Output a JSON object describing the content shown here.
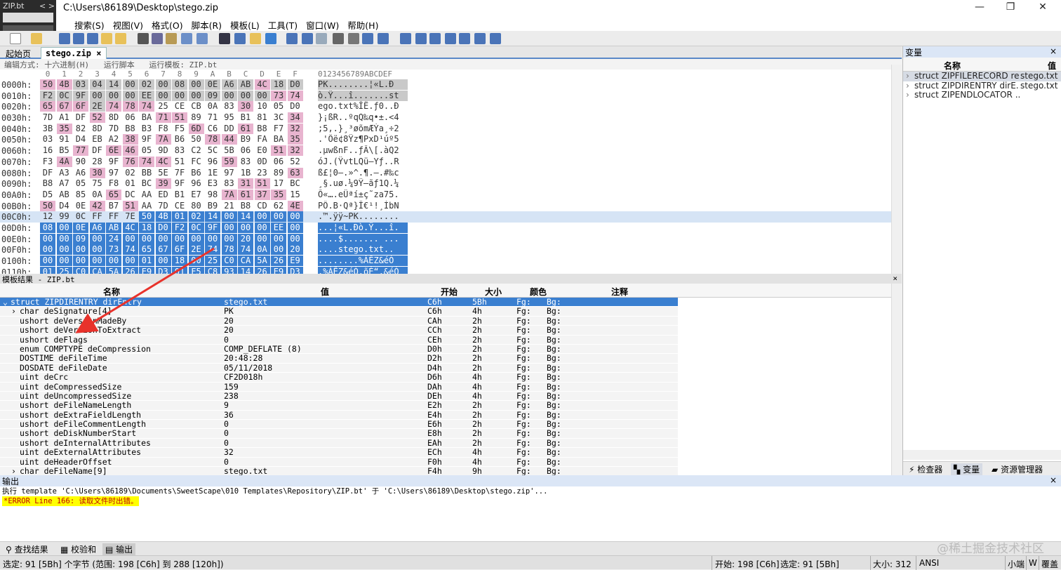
{
  "window": {
    "title": "C:\\Users\\86189\\Desktop\\stego.zip",
    "mini_tab_label": "ZIP.bt",
    "mini_tab_nav": "< >",
    "minimize": "—",
    "maximize": "❐",
    "close": "✕"
  },
  "menu": [
    "搜索(S)",
    "视图(V)",
    "格式(O)",
    "脚本(R)",
    "模板(L)",
    "工具(T)",
    "窗口(W)",
    "帮助(H)"
  ],
  "tabs": {
    "start": "起始页",
    "file": "stego.zip",
    "file_close": "×"
  },
  "hex_info": {
    "edit_mode": "编辑方式: 十六进制(H)",
    "run_script": "运行脚本",
    "run_template": "运行模板: ZIP.bt"
  },
  "hex_col_labels": [
    "0",
    "1",
    "2",
    "3",
    "4",
    "5",
    "6",
    "7",
    "8",
    "9",
    "A",
    "B",
    "C",
    "D",
    "E",
    "F"
  ],
  "hex_ascii_header": "0123456789ABCDEF",
  "hex_rows": [
    {
      "off": "0000h:",
      "b": [
        "50",
        "4B",
        "03",
        "04",
        "14",
        "00",
        "02",
        "00",
        "08",
        "00",
        "0E",
        "A6",
        "AB",
        "4C",
        "18",
        "D0"
      ],
      "a": "PK........¦«L.Ð"
    },
    {
      "off": "0010h:",
      "b": [
        "F2",
        "0C",
        "9F",
        "00",
        "00",
        "00",
        "EE",
        "00",
        "00",
        "00",
        "09",
        "00",
        "00",
        "00",
        "73",
        "74"
      ],
      "a": "ò.Ÿ...î.......st"
    },
    {
      "off": "0020h:",
      "b": [
        "65",
        "67",
        "6F",
        "2E",
        "74",
        "78",
        "74",
        "25",
        "CE",
        "CB",
        "0A",
        "83",
        "30",
        "10",
        "05",
        "D0"
      ],
      "a": "ego.txt%ÎË.ƒ0..Ð"
    },
    {
      "off": "0030h:",
      "b": [
        "7D",
        "A1",
        "DF",
        "52",
        "8D",
        "06",
        "BA",
        "71",
        "51",
        "89",
        "71",
        "95",
        "B1",
        "81",
        "3C",
        "34"
      ],
      "a": "}¡ßR..ºqQ‰q•±.<4"
    },
    {
      "off": "0040h:",
      "b": [
        "3B",
        "35",
        "82",
        "8D",
        "7D",
        "B8",
        "B3",
        "F8",
        "F5",
        "6D",
        "C6",
        "DD",
        "61",
        "B8",
        "F7",
        "32"
      ],
      "a": ";5‚.}¸³øõmÆÝa¸÷2"
    },
    {
      "off": "0050h:",
      "b": [
        "03",
        "91",
        "D4",
        "EB",
        "A2",
        "38",
        "9F",
        "7A",
        "B6",
        "50",
        "78",
        "44",
        "B9",
        "FA",
        "BA",
        "35"
      ],
      "a": ".'Ôë¢8Ÿz¶PxD¹úº5"
    },
    {
      "off": "0060h:",
      "b": [
        "16",
        "B5",
        "77",
        "DF",
        "6E",
        "46",
        "05",
        "9D",
        "83",
        "C2",
        "5C",
        "5B",
        "06",
        "E0",
        "51",
        "32"
      ],
      "a": ".µwßnF..ƒÂ\\[.àQ2"
    },
    {
      "off": "0070h:",
      "b": [
        "F3",
        "4A",
        "90",
        "28",
        "9F",
        "76",
        "74",
        "4C",
        "51",
        "FC",
        "96",
        "59",
        "83",
        "0D",
        "06",
        "52"
      ],
      "a": "óJ.(ŸvtLQü–Yƒ..R"
    },
    {
      "off": "0080h:",
      "b": [
        "DF",
        "A3",
        "A6",
        "30",
        "97",
        "02",
        "BB",
        "5E",
        "7F",
        "B6",
        "1E",
        "97",
        "1B",
        "23",
        "89",
        "63"
      ],
      "a": "ß£¦0—.»^.¶.—.#‰c"
    },
    {
      "off": "0090h:",
      "b": [
        "B8",
        "A7",
        "05",
        "75",
        "F8",
        "01",
        "BC",
        "39",
        "9F",
        "96",
        "E3",
        "83",
        "31",
        "51",
        "17",
        "BC"
      ],
      "a": "¸§.uø.¼9Ÿ–ãƒ1Q.¼"
    },
    {
      "off": "00A0h:",
      "b": [
        "D5",
        "AB",
        "85",
        "0A",
        "65",
        "DC",
        "AA",
        "ED",
        "B1",
        "E7",
        "98",
        "7A",
        "61",
        "37",
        "35",
        "15"
      ],
      "a": "Õ«….eÜªí±ç˜za75."
    },
    {
      "off": "00B0h:",
      "b": [
        "50",
        "D4",
        "0E",
        "42",
        "B7",
        "51",
        "AA",
        "7D",
        "CE",
        "80",
        "B9",
        "21",
        "B8",
        "CD",
        "62",
        "4E"
      ],
      "a": "PÔ.B·Qª}Î€¹!¸ÍbN"
    },
    {
      "off": "00C0h:",
      "b": [
        "12",
        "99",
        "0C",
        "FF",
        "FF",
        "7E",
        "50",
        "4B",
        "01",
        "02",
        "14",
        "00",
        "14",
        "00",
        "00",
        "00"
      ],
      "a": ".™.ÿÿ~PK........"
    },
    {
      "off": "00D0h:",
      "b": [
        "08",
        "00",
        "0E",
        "A6",
        "AB",
        "4C",
        "18",
        "D0",
        "F2",
        "0C",
        "9F",
        "00",
        "00",
        "00",
        "EE",
        "00"
      ],
      "a": "...¦«L.Ðò.Ÿ...î."
    },
    {
      "off": "00E0h:",
      "b": [
        "00",
        "00",
        "09",
        "00",
        "24",
        "00",
        "00",
        "00",
        "00",
        "00",
        "00",
        "00",
        "20",
        "00",
        "00",
        "00"
      ],
      "a": "....$....... ..."
    },
    {
      "off": "00F0h:",
      "b": [
        "00",
        "00",
        "00",
        "00",
        "73",
        "74",
        "65",
        "67",
        "6F",
        "2E",
        "74",
        "78",
        "74",
        "0A",
        "00",
        "20"
      ],
      "a": "....stego.txt.. "
    },
    {
      "off": "0100h:",
      "b": [
        "00",
        "00",
        "00",
        "00",
        "00",
        "00",
        "01",
        "00",
        "18",
        "00",
        "25",
        "C0",
        "CA",
        "5A",
        "26",
        "E9",
        "D3"
      ],
      "a": "........%ÀÊZ&éÓ"
    },
    {
      "off": "0110h:",
      "b": [
        "01",
        "25",
        "C0",
        "CA",
        "5A",
        "26",
        "E9",
        "D3",
        "01",
        "F5",
        "C8",
        "93",
        "14",
        "26",
        "E9",
        "D3"
      ],
      "a": ".%ÀÊZ&éÓ.õÈ“.&éÓ"
    }
  ],
  "template": {
    "title": "模板结果 - ZIP.bt",
    "close": "×",
    "headers": {
      "name": "名称",
      "value": "值",
      "start": "开始",
      "size": "大小",
      "color": "颜色",
      "comment": "注释"
    },
    "rows": [
      {
        "name": "struct ZIPDIRENTRY dirEntry",
        "value": "stego.txt",
        "start": "C6h",
        "size": "5Bh",
        "fg": "Fg:",
        "bg": "Bg:"
      },
      {
        "name": "char deSignature[4]",
        "value": "PK",
        "start": "C6h",
        "size": "4h",
        "fg": "Fg:",
        "bg": "Bg:"
      },
      {
        "name": "ushort deVersionMadeBy",
        "value": "20",
        "start": "CAh",
        "size": "2h",
        "fg": "Fg:",
        "bg": "Bg:"
      },
      {
        "name": "ushort deVersionToExtract",
        "value": "20",
        "start": "CCh",
        "size": "2h",
        "fg": "Fg:",
        "bg": "Bg:"
      },
      {
        "name": "ushort deFlags",
        "value": "0",
        "start": "CEh",
        "size": "2h",
        "fg": "Fg:",
        "bg": "Bg:"
      },
      {
        "name": "enum COMPTYPE deCompression",
        "value": "COMP_DEFLATE (8)",
        "start": "D0h",
        "size": "2h",
        "fg": "Fg:",
        "bg": "Bg:"
      },
      {
        "name": "DOSTIME deFileTime",
        "value": "20:48:28",
        "start": "D2h",
        "size": "2h",
        "fg": "Fg:",
        "bg": "Bg:"
      },
      {
        "name": "DOSDATE deFileDate",
        "value": "05/11/2018",
        "start": "D4h",
        "size": "2h",
        "fg": "Fg:",
        "bg": "Bg:"
      },
      {
        "name": "uint deCrc",
        "value": "CF2D018h",
        "start": "D6h",
        "size": "4h",
        "fg": "Fg:",
        "bg": "Bg:"
      },
      {
        "name": "uint deCompressedSize",
        "value": "159",
        "start": "DAh",
        "size": "4h",
        "fg": "Fg:",
        "bg": "Bg:"
      },
      {
        "name": "uint deUncompressedSize",
        "value": "238",
        "start": "DEh",
        "size": "4h",
        "fg": "Fg:",
        "bg": "Bg:"
      },
      {
        "name": "ushort deFileNameLength",
        "value": "9",
        "start": "E2h",
        "size": "2h",
        "fg": "Fg:",
        "bg": "Bg:"
      },
      {
        "name": "ushort deExtraFieldLength",
        "value": "36",
        "start": "E4h",
        "size": "2h",
        "fg": "Fg:",
        "bg": "Bg:"
      },
      {
        "name": "ushort deFileCommentLength",
        "value": "0",
        "start": "E6h",
        "size": "2h",
        "fg": "Fg:",
        "bg": "Bg:"
      },
      {
        "name": "ushort deDiskNumberStart",
        "value": "0",
        "start": "E8h",
        "size": "2h",
        "fg": "Fg:",
        "bg": "Bg:"
      },
      {
        "name": "ushort deInternalAttributes",
        "value": "0",
        "start": "EAh",
        "size": "2h",
        "fg": "Fg:",
        "bg": "Bg:"
      },
      {
        "name": "uint deExternalAttributes",
        "value": "32",
        "start": "ECh",
        "size": "4h",
        "fg": "Fg:",
        "bg": "Bg:"
      },
      {
        "name": "uint deHeaderOffset",
        "value": "0",
        "start": "F0h",
        "size": "4h",
        "fg": "Fg:",
        "bg": "Bg:"
      },
      {
        "name": "char deFileName[9]",
        "value": "stego.txt",
        "start": "F4h",
        "size": "9h",
        "fg": "Fg:",
        "bg": "Bg:"
      }
    ]
  },
  "variables": {
    "title": "变量",
    "close": "×",
    "header_name": "名称",
    "header_value": "值",
    "rows": [
      {
        "name": "struct ZIPFILERECORD re...",
        "value": "stego.txt"
      },
      {
        "name": "struct ZIPDIRENTRY dirE...",
        "value": "stego.txt"
      },
      {
        "name": "struct ZIPENDLOCATOR ...",
        "value": ""
      }
    ],
    "tabs": [
      "检查器",
      "变量",
      "资源管理器"
    ]
  },
  "output": {
    "title": "输出",
    "close": "×",
    "line1": "执行 template 'C:\\Users\\86189\\Documents\\SweetScape\\010 Templates\\Repository\\ZIP.bt' 于 'C:\\Users\\86189\\Desktop\\stego.zip'...",
    "error": "*ERROR Line 166: 读取文件时出错。",
    "tabs": [
      "查找结果",
      "校验和",
      "输出"
    ]
  },
  "watermark": "@稀土掘金技术社区",
  "status": {
    "selection": "选定: 91 [5Bh] 个字节 (范围: 198 [C6h] 到 288 [120h])",
    "start": "开始: 198 [C6h]",
    "sel": "选定: 91 [5Bh]",
    "size": "大小: 312",
    "encoding": "ANSI",
    "endian": "小端",
    "w": "W",
    "mode": "覆盖"
  },
  "colors": {
    "highlight_pink": "#e8b4cf",
    "selection_blue": "#3a7fd0",
    "arrow_red": "#e8322b",
    "error_bg": "#ffff00"
  }
}
